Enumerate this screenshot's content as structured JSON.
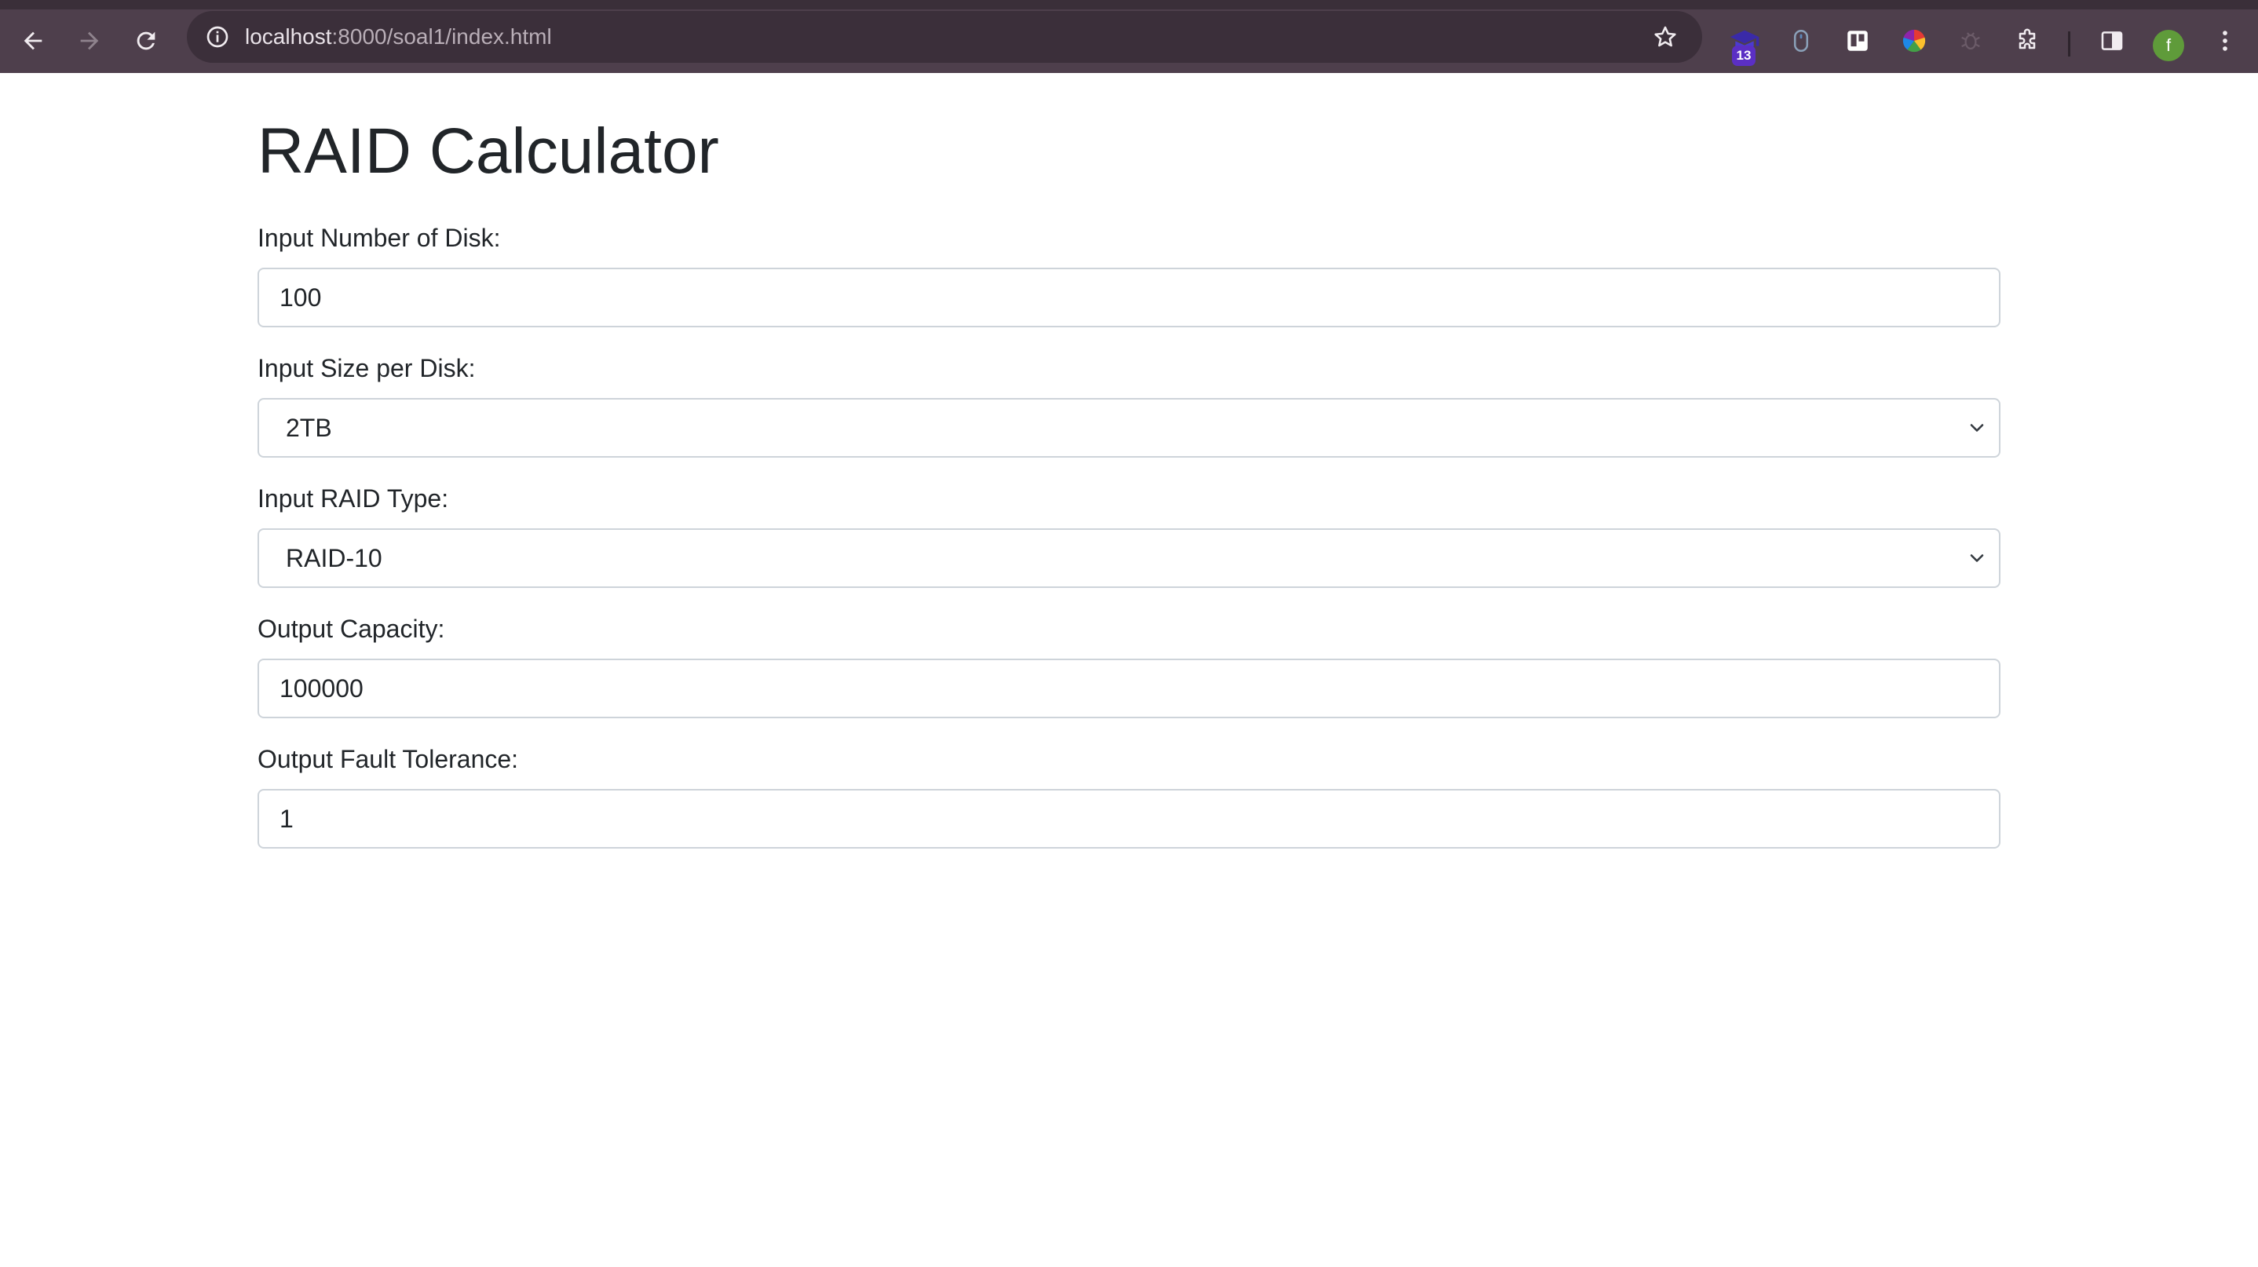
{
  "browser": {
    "url_host": "localhost",
    "url_path": ":8000/soal1/index.html",
    "extension_badge": "13",
    "profile_initial": "f",
    "icons": [
      "back-arrow-icon",
      "forward-arrow-icon",
      "reload-icon",
      "site-info-icon",
      "bookmark-star-icon",
      "graduation-cap-extension-icon",
      "mouse-extension-icon",
      "trello-extension-icon",
      "color-wheel-extension-icon",
      "bug-extension-icon",
      "extensions-puzzle-icon",
      "side-panel-icon",
      "more-vert-icon"
    ]
  },
  "page": {
    "title": "RAID Calculator",
    "fields": {
      "disk_count": {
        "label": "Input Number of Disk:",
        "value": "100"
      },
      "disk_size": {
        "label": "Input Size per Disk:",
        "value": "2TB"
      },
      "raid_type": {
        "label": "Input RAID Type:",
        "value": "RAID-10"
      },
      "capacity": {
        "label": "Output Capacity:",
        "value": "100000"
      },
      "fault_tolerance": {
        "label": "Output Fault Tolerance:",
        "value": "1"
      }
    }
  }
}
